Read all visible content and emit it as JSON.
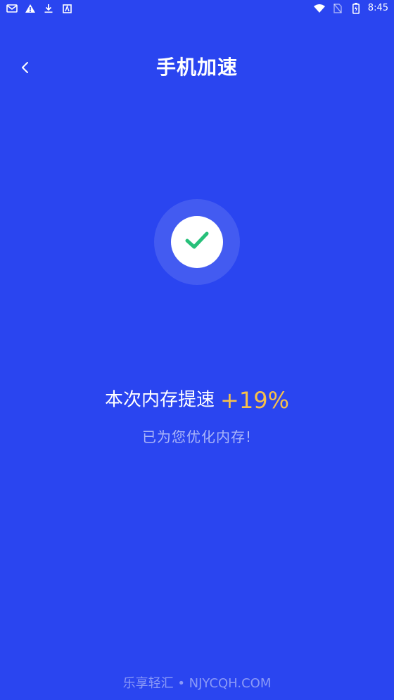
{
  "status_bar": {
    "time": "8:45",
    "left_icons": [
      "mail-icon",
      "warning-icon",
      "download-icon",
      "app-icon"
    ],
    "right_icons": [
      "wifi-icon",
      "no-sim-icon",
      "battery-icon"
    ]
  },
  "header": {
    "title": "手机加速",
    "back_icon": "chevron-left-icon"
  },
  "result": {
    "label": "本次内存提速",
    "value": "+19%",
    "subtitle": "已为您优化内存!",
    "value_color": "#f7c04a"
  },
  "watermark": "乐享轻汇 • NJYCQH.COM",
  "colors": {
    "background": "#2a45f0",
    "check": "#27c07a",
    "accent": "#f7c04a"
  }
}
